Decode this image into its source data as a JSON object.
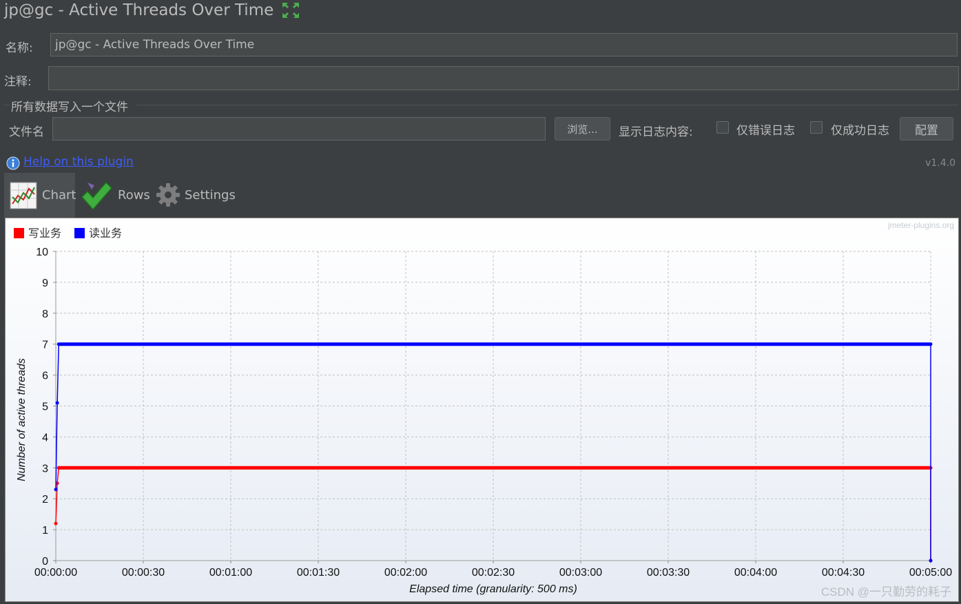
{
  "window": {
    "title": "jp@gc - Active Threads Over Time"
  },
  "form": {
    "name_label": "名称:",
    "name_value": "jp@gc - Active Threads Over Time",
    "comment_label": "注释:",
    "comment_value": "",
    "file_section_title": "所有数据写入一个文件",
    "filename_label": "文件名",
    "filename_value": "",
    "browse_label": "浏览...",
    "log_content_label": "显示日志内容:",
    "errors_only_label": "仅错误日志",
    "errors_only_checked": false,
    "success_only_label": "仅成功日志",
    "success_only_checked": false,
    "configure_label": "配置"
  },
  "help": {
    "link_text": "Help on this plugin",
    "version": "v1.4.0"
  },
  "tabs": [
    {
      "label": "Chart",
      "icon": "line-chart-icon",
      "selected": true
    },
    {
      "label": "Rows",
      "icon": "checkmark-icon",
      "selected": false
    },
    {
      "label": "Settings",
      "icon": "gear-icon",
      "selected": false
    }
  ],
  "watermark": "jmeter-plugins.org",
  "footer_watermark": "CSDN @一只勤劳的耗子",
  "chart_data": {
    "type": "line",
    "xlabel": "Elapsed time (granularity: 500 ms)",
    "ylabel": "Number of active threads",
    "ylim": [
      0,
      10
    ],
    "yticks": [
      "0",
      "1",
      "2",
      "3",
      "4",
      "5",
      "6",
      "7",
      "8",
      "9",
      "10"
    ],
    "xlim_seconds": [
      0,
      300
    ],
    "xticks": [
      "00:00:00",
      "00:00:30",
      "00:01:00",
      "00:01:30",
      "00:02:00",
      "00:02:30",
      "00:03:00",
      "00:03:30",
      "00:04:00",
      "00:04:30",
      "00:05:00"
    ],
    "grid": true,
    "legend_position": "top-left",
    "series": [
      {
        "name": "写业务",
        "color": "#ff0000",
        "x": [
          0,
          0.5,
          1,
          300,
          300
        ],
        "y": [
          1.2,
          2.5,
          3,
          3,
          0
        ]
      },
      {
        "name": "读业务",
        "color": "#0000ff",
        "x": [
          0,
          0.5,
          1,
          300,
          300
        ],
        "y": [
          2.3,
          5.1,
          7,
          7,
          0
        ]
      }
    ]
  }
}
